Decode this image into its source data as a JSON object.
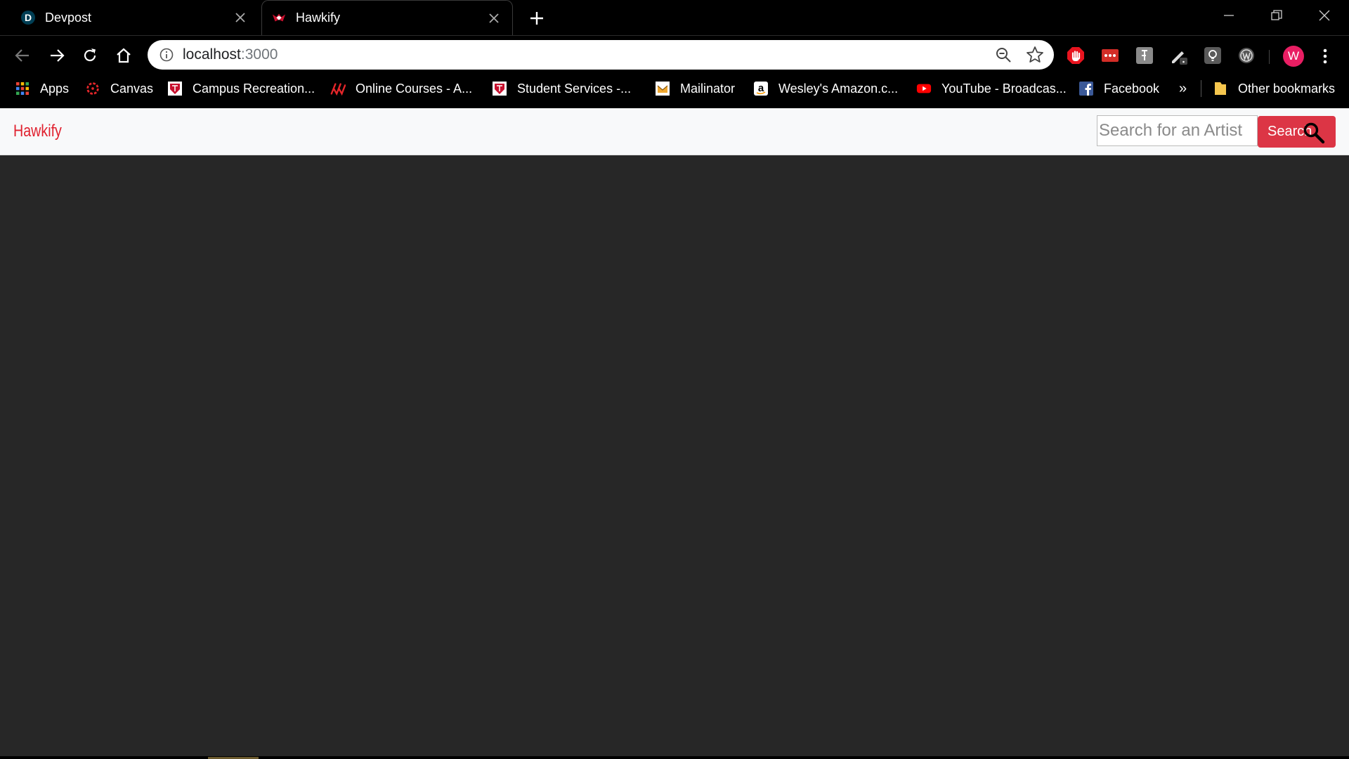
{
  "tabs": [
    {
      "title": "Devpost",
      "icon": "devpost-icon",
      "favicon_letter": "D"
    },
    {
      "title": "Hawkify",
      "icon": "hawkify-favicon-icon",
      "active": true
    }
  ],
  "toolbar": {
    "url_host": "localhost",
    "url_port": ":3000"
  },
  "bookmarks": [
    {
      "label": "Apps",
      "icon": "apps-grid-icon"
    },
    {
      "label": "Canvas",
      "icon": "canvas-icon"
    },
    {
      "label": "Campus Recreation...",
      "icon": "campus-recreation-icon"
    },
    {
      "label": "Online Courses - A...",
      "icon": "online-courses-icon"
    },
    {
      "label": "Student Services -...",
      "icon": "student-services-icon"
    },
    {
      "label": "Mailinator",
      "icon": "mailinator-icon"
    },
    {
      "label": "Wesley's Amazon.c...",
      "icon": "amazon-icon"
    },
    {
      "label": "YouTube - Broadcas...",
      "icon": "youtube-icon"
    },
    {
      "label": "Facebook",
      "icon": "facebook-icon"
    }
  ],
  "bookmarks_overflow": "»",
  "other_bookmarks": "Other bookmarks",
  "profile_initial": "W",
  "app": {
    "brand": "Hawkify",
    "search_placeholder": "Search for an Artist",
    "search_button": "Search"
  },
  "colors": {
    "brand_red": "#e0202e",
    "button_red": "#dc3545",
    "page_background": "#272727",
    "navbar_background": "#f8f9fa"
  }
}
